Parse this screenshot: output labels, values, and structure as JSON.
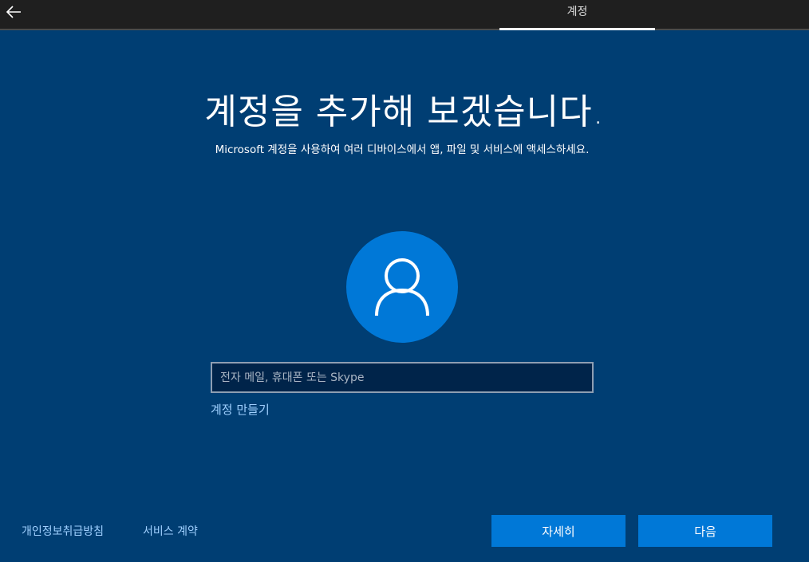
{
  "header": {
    "back_icon": "back-arrow-icon",
    "tab_label": "계정"
  },
  "main": {
    "title": "계정을 추가해 보겠습니다.",
    "subtitle": "Microsoft 계정을 사용하여 여러 디바이스에서 앱, 파일 및 서비스에 액세스하세요.",
    "avatar_icon": "user-icon",
    "email_placeholder": "전자 메일, 휴대폰 또는 Skype",
    "email_value": "",
    "create_account_label": "계정 만들기"
  },
  "footer": {
    "privacy_label": "개인정보취급방침",
    "terms_label": "서비스 계약",
    "learn_more_label": "자세히",
    "next_label": "다음"
  },
  "colors": {
    "background": "#003e73",
    "accent": "#0078d7",
    "topbar": "#1f1f1f",
    "link": "#9fd0ff",
    "input_background": "#00244a"
  }
}
